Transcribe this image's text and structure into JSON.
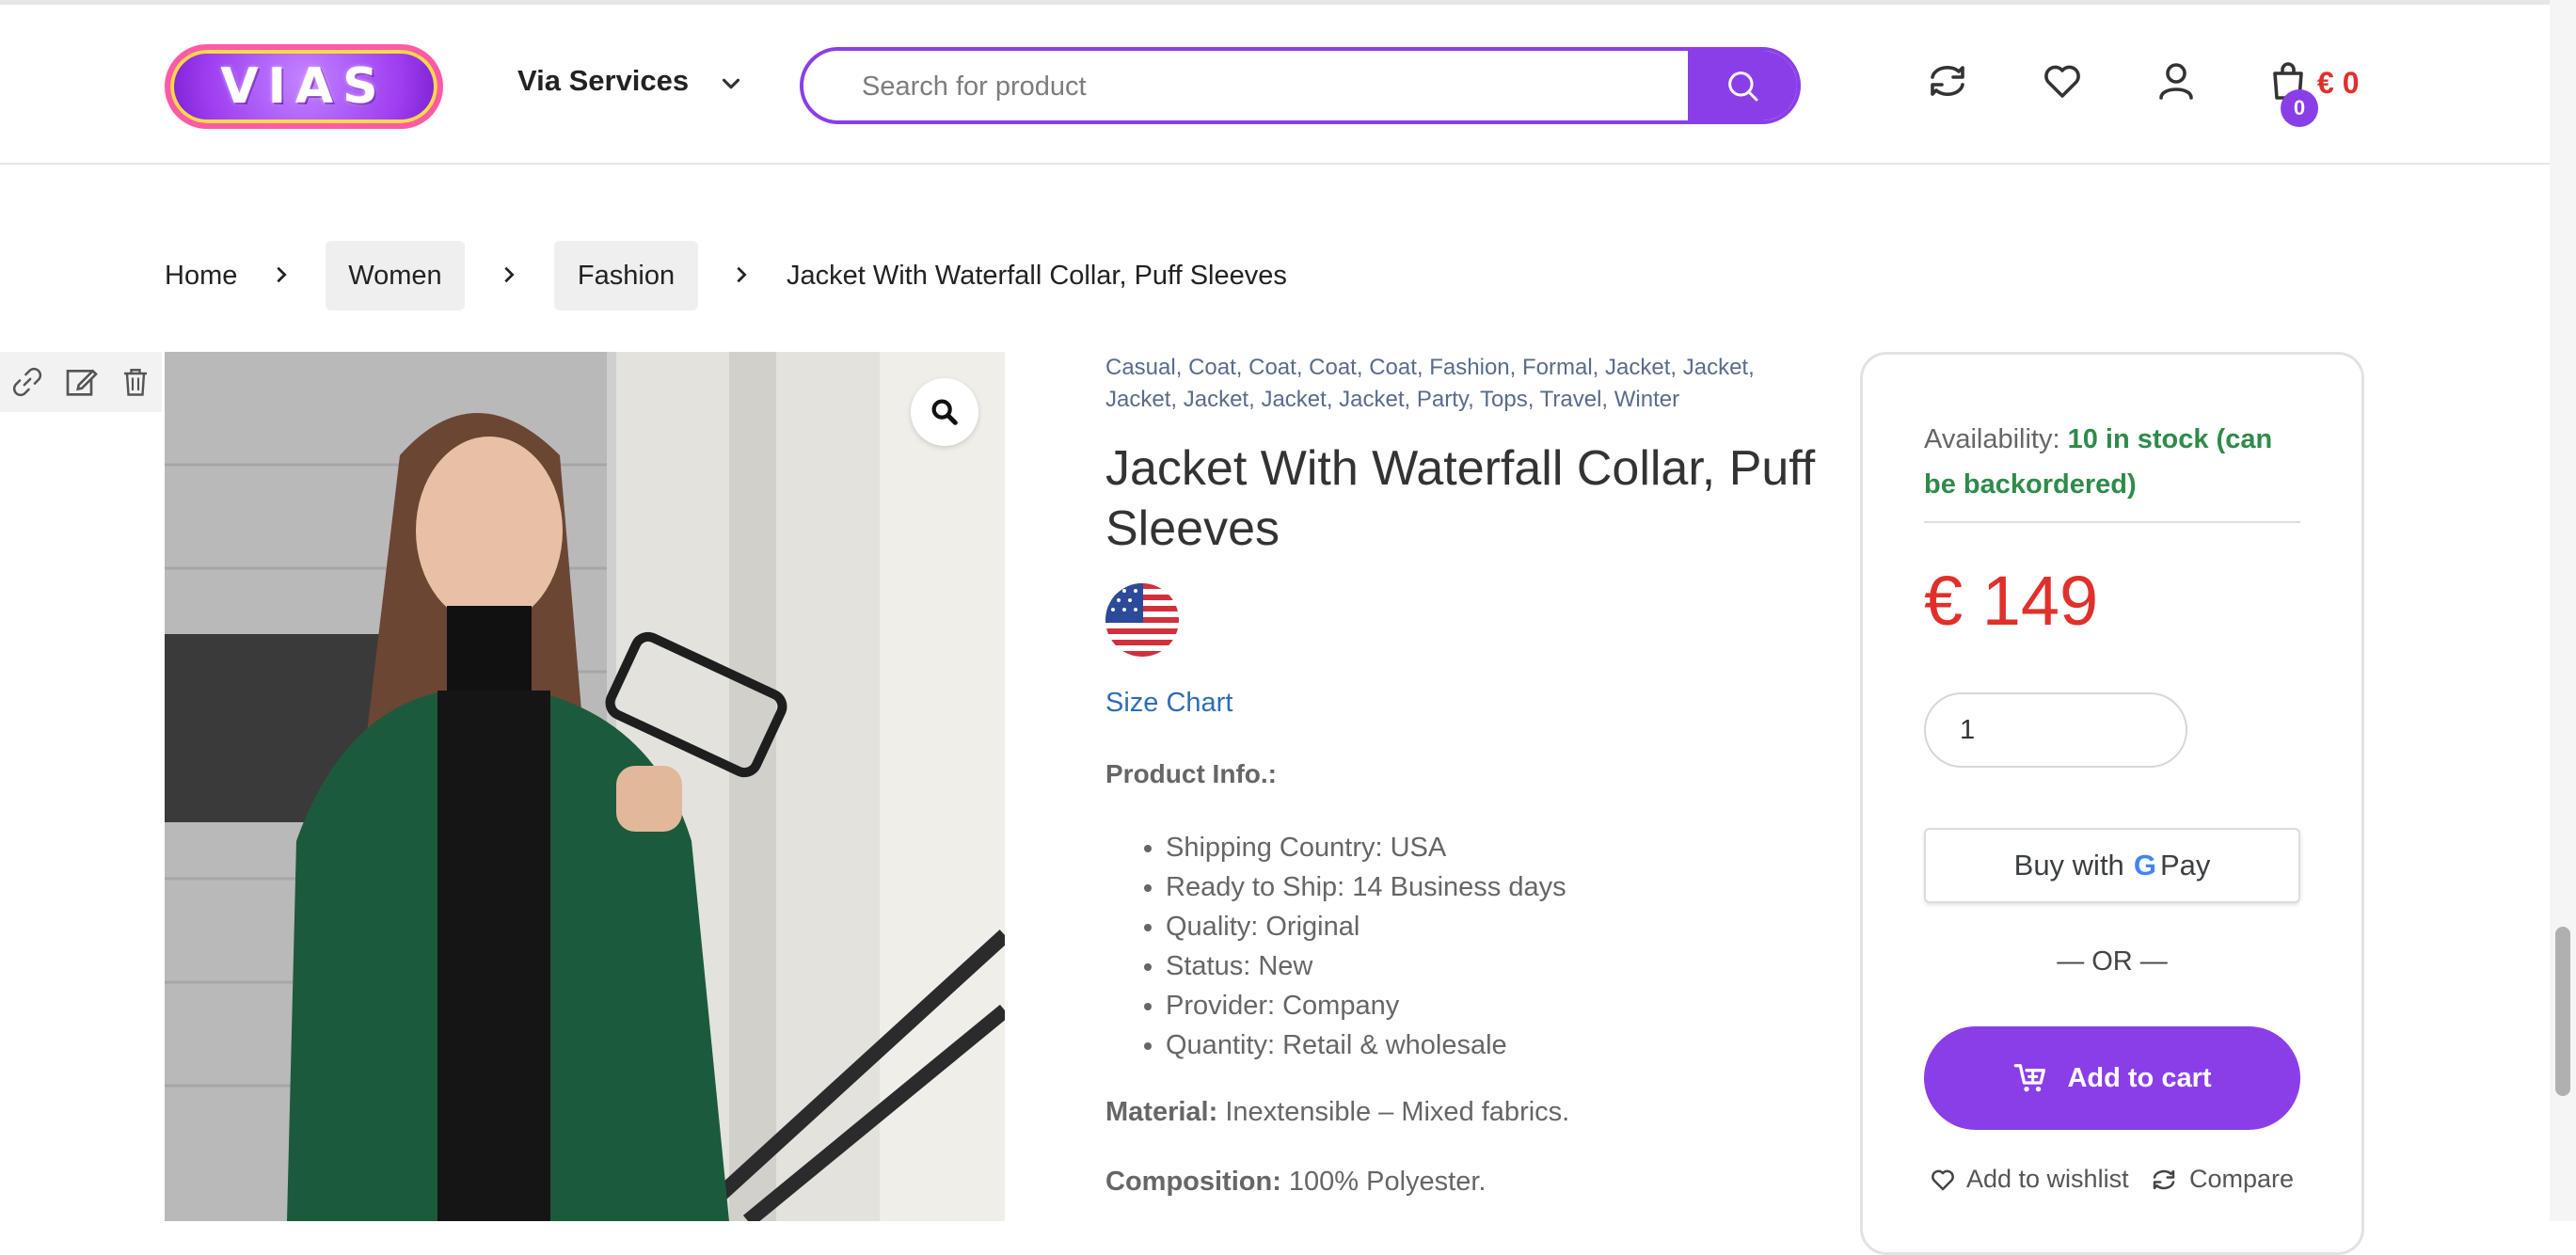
{
  "header": {
    "logo_text": "VIAS",
    "nav_services": "Via Services",
    "search_placeholder": "Search for product",
    "cart_count": "0",
    "cart_total": "€ 0"
  },
  "breadcrumb": {
    "home": "Home",
    "women": "Women",
    "fashion": "Fashion",
    "current": "Jacket With Waterfall Collar, Puff Sleeves"
  },
  "product": {
    "tags": [
      "Casual",
      "Coat",
      "Coat",
      "Coat",
      "Coat",
      "Fashion",
      "Formal",
      "Jacket",
      "Jacket",
      "Jacket",
      "Jacket",
      "Jacket",
      "Jacket",
      "Party",
      "Tops",
      "Travel",
      "Winter"
    ],
    "title": "Jacket With Waterfall Collar, Puff Sleeves",
    "size_chart": "Size Chart",
    "info_heading": "Product Info.:",
    "info_items": [
      "Shipping Country: USA",
      "Ready to Ship: 14 Business days",
      "Quality: Original",
      "Status: New",
      "Provider: Company",
      "Quantity: Retail & wholesale"
    ],
    "material_label": "Material:",
    "material_value": " Inextensible – Mixed fabrics.",
    "composition_label": "Composition:",
    "composition_value": " 100% Polyester."
  },
  "buybox": {
    "availability_label": "Availability: ",
    "availability_value": "10 in stock (can be backordered)",
    "price": "€ 149",
    "quantity": "1",
    "gpay_prefix": "Buy with",
    "gpay_g": "G",
    "gpay_pay": "Pay",
    "or_text": "— OR —",
    "add_to_cart": "Add to cart",
    "add_to_wishlist": "Add to wishlist",
    "compare": "Compare"
  },
  "colors": {
    "accent": "#8a3ee8",
    "price": "#e0302a",
    "in_stock": "#2e8b4a",
    "link": "#2e6db4"
  }
}
